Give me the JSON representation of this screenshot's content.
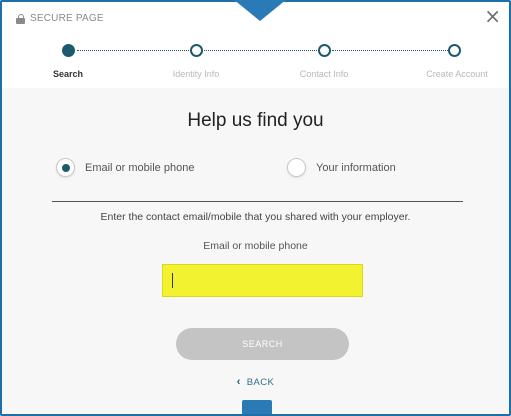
{
  "header": {
    "secure_label": "SECURE PAGE",
    "close_glyph": "×"
  },
  "steps": [
    {
      "label": "Search",
      "active": true
    },
    {
      "label": "Identity Info",
      "active": false
    },
    {
      "label": "Contact Info",
      "active": false
    },
    {
      "label": "Create Account",
      "active": false
    }
  ],
  "main": {
    "title": "Help us find you",
    "options": [
      {
        "label": "Email or mobile phone",
        "selected": true
      },
      {
        "label": "Your information",
        "selected": false
      }
    ],
    "hint": "Enter the contact email/mobile that you shared with your employer.",
    "field_label": "Email or mobile phone",
    "input_value": "",
    "search_label": "SEARCH",
    "back_label": "BACK"
  },
  "colors": {
    "accent": "#1e5a6e",
    "frame": "#2a7ab5",
    "input_highlight": "#f2f230",
    "button_disabled": "#c4c4c4"
  }
}
